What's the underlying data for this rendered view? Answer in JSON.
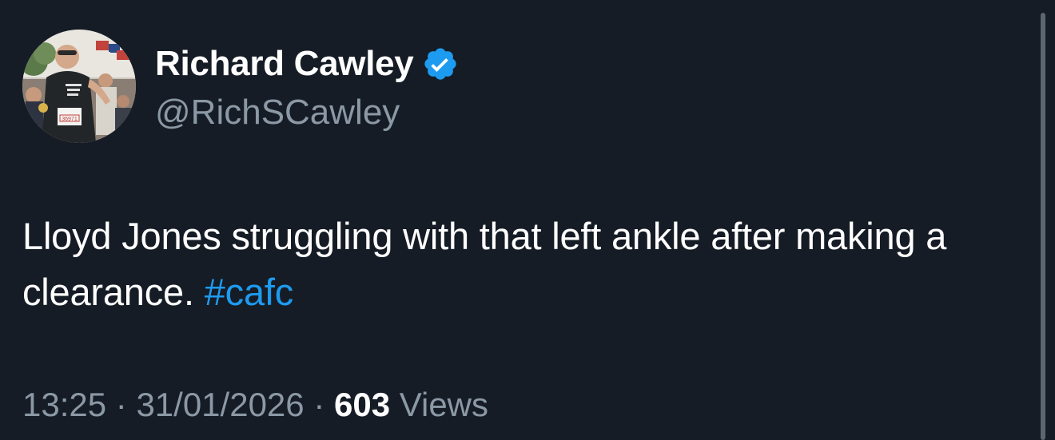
{
  "tweet": {
    "author": {
      "display_name": "Richard Cawley",
      "handle": "@RichSCawley",
      "verified": true,
      "avatar_icon": "profile-photo-runner",
      "avatar_bib_number": "36971"
    },
    "body": {
      "text": "Lloyd Jones struggling with that left ankle after making a clearance. ",
      "hashtag": "#cafc"
    },
    "meta": {
      "time": "13:25",
      "separator": " · ",
      "date": "31/01/2026",
      "views_count": "603",
      "views_label": " Views"
    }
  },
  "colors": {
    "background": "#161c25",
    "primary_text": "#ffffff",
    "secondary_text": "#8b98a5",
    "accent": "#1d9bf0",
    "verified_badge": "#1d9bf0"
  }
}
